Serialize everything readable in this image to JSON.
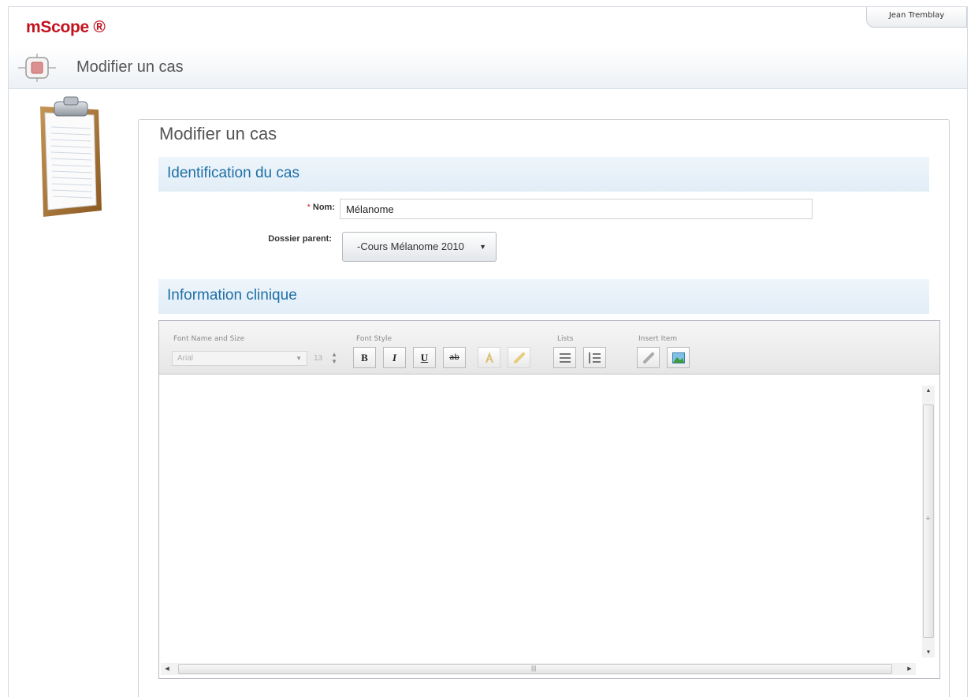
{
  "app": {
    "brand": "mScope ®",
    "user_name": "Jean Tremblay",
    "header_title": "Modifier un cas"
  },
  "form": {
    "legend": "Modifier un cas",
    "identification_section": "Identification du cas",
    "name_label": "Nom:",
    "required_marker": "*",
    "name_value": "Mélanome",
    "parent_label": "Dossier parent:",
    "parent_value": "-Cours Mélanome 2010",
    "clinical_section": "Information clinique"
  },
  "editor": {
    "groups": {
      "font_name_size": "Font Name and Size",
      "font_style": "Font Style",
      "lists": "Lists",
      "insert_item": "Insert Item"
    },
    "font_name": "Arial",
    "font_size": "13",
    "buttons": {
      "bold": "B",
      "italic": "I",
      "underline": "U",
      "strike": "ab"
    }
  },
  "colors": {
    "brand": "#c2121d",
    "section_text": "#1d6fa5",
    "section_bg": "#e2edf7"
  }
}
